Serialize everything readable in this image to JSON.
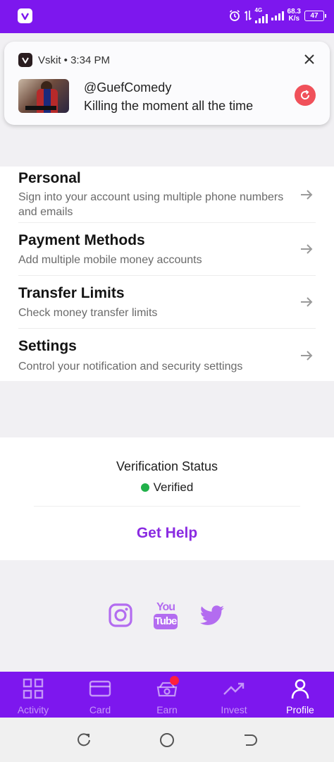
{
  "status_bar": {
    "network_type": "4G",
    "speed_value": "68.3",
    "speed_unit": "K/s",
    "battery": "47",
    "app_icon": "vskit-logo-icon",
    "alarm_icon": "alarm-icon"
  },
  "notification": {
    "app_name": "Vskit",
    "time": "3:34 PM",
    "header": "Vskit • 3:34 PM",
    "title": "@GuefComedy",
    "body": "Killing the moment all the time",
    "close_icon": "close-icon",
    "action_icon": "refresh-icon"
  },
  "menu": {
    "items": [
      {
        "title": "Personal",
        "description": "Sign into your account using multiple phone numbers and emails",
        "icon": "arrow-right-icon"
      },
      {
        "title": "Payment Methods",
        "description": "Add multiple mobile money accounts",
        "icon": "arrow-right-icon"
      },
      {
        "title": "Transfer Limits",
        "description": "Check money transfer limits",
        "icon": "arrow-right-icon"
      },
      {
        "title": "Settings",
        "description": "Control your notification and security settings",
        "icon": "arrow-right-icon"
      }
    ]
  },
  "verification": {
    "label": "Verification Status",
    "status": "Verified",
    "status_color": "#21b14a",
    "help_label": "Get Help"
  },
  "social": {
    "icons": [
      "instagram-icon",
      "youtube-icon",
      "twitter-icon"
    ],
    "youtube_top": "You",
    "youtube_bottom": "Tube"
  },
  "bottom_nav": {
    "items": [
      {
        "label": "Activity",
        "icon": "grid-icon",
        "active": false
      },
      {
        "label": "Card",
        "icon": "card-icon",
        "active": false
      },
      {
        "label": "Earn",
        "icon": "earn-icon",
        "active": false,
        "badge": true
      },
      {
        "label": "Invest",
        "icon": "trend-up-icon",
        "active": false
      },
      {
        "label": "Profile",
        "icon": "person-icon",
        "active": true
      }
    ]
  },
  "colors": {
    "brand": "#7d17ee",
    "accent_text": "#8a2be2",
    "social_icon": "#b36cf0",
    "badge": "#ff1f3d"
  }
}
